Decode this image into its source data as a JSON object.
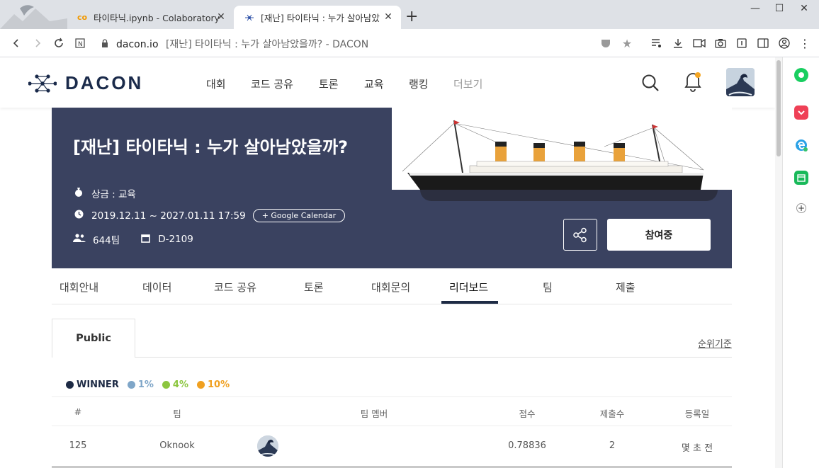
{
  "browser": {
    "tabs": [
      {
        "title": "타이타닉.ipynb - Colaboratory",
        "icon": "colab-icon"
      },
      {
        "title": "[재난] 타이타닉 : 누가 살아남았",
        "icon": "dacon-icon"
      }
    ],
    "url_domain": "dacon.io",
    "url_title": "[재난] 타이타닉 : 누가 살아남았을까? - DACON"
  },
  "site": {
    "logo": "DACON",
    "nav": [
      "대회",
      "코드 공유",
      "토론",
      "교육",
      "랭킹",
      "더보기"
    ]
  },
  "competition": {
    "title": "[재난] 타이타닉 : 누가 살아남았을까?",
    "prize": "상금 : 교육",
    "period": "2019.12.11 ~ 2027.01.11 17:59",
    "calendar_button": "+ Google Calendar",
    "teams": "644팀",
    "dday": "D-2109",
    "join_button": "참여중"
  },
  "subtabs": [
    "대회안내",
    "데이터",
    "코드 공유",
    "토론",
    "대회문의",
    "리더보드",
    "팀",
    "제출"
  ],
  "leaderboard": {
    "tab": "Public",
    "rank_basis": "순위기준",
    "legend": [
      {
        "label": "WINNER",
        "color": "#1e2b45"
      },
      {
        "label": "1%",
        "color": "#7fa6c8"
      },
      {
        "label": "4%",
        "color": "#8cc63f"
      },
      {
        "label": "10%",
        "color": "#f0a020"
      }
    ],
    "columns": [
      "#",
      "팀",
      "팀 멤버",
      "점수",
      "제출수",
      "등록일"
    ],
    "rows": [
      {
        "rank": "125",
        "team": "Oknook",
        "score": "0.78836",
        "submissions": "2",
        "date": "몇 초 전"
      }
    ]
  }
}
